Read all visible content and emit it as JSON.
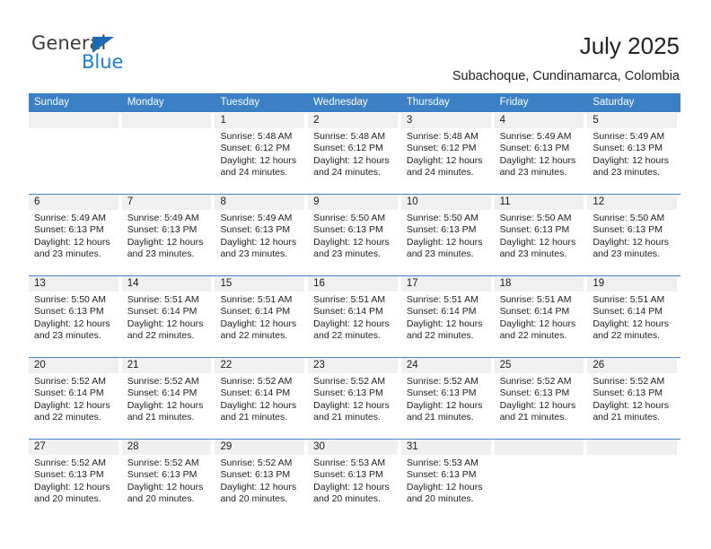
{
  "brand": {
    "name_part1": "General",
    "name_part2": "Blue",
    "flag_color": "#1a6ab4",
    "blue_color": "#1b7fd4"
  },
  "header": {
    "title": "July 2025",
    "subtitle": "Subachoque, Cundinamarca, Colombia"
  },
  "calendar": {
    "header_bg": "#3b7fc4",
    "date_band_bg": "#f0f0f0",
    "separator_color": "#4a86c5",
    "weekdays": [
      "Sunday",
      "Monday",
      "Tuesday",
      "Wednesday",
      "Thursday",
      "Friday",
      "Saturday"
    ],
    "weeks": [
      [
        {
          "day": "",
          "sunrise": "",
          "sunset": "",
          "daylight1": "",
          "daylight2": ""
        },
        {
          "day": "",
          "sunrise": "",
          "sunset": "",
          "daylight1": "",
          "daylight2": ""
        },
        {
          "day": "1",
          "sunrise": "Sunrise: 5:48 AM",
          "sunset": "Sunset: 6:12 PM",
          "daylight1": "Daylight: 12 hours",
          "daylight2": "and 24 minutes."
        },
        {
          "day": "2",
          "sunrise": "Sunrise: 5:48 AM",
          "sunset": "Sunset: 6:12 PM",
          "daylight1": "Daylight: 12 hours",
          "daylight2": "and 24 minutes."
        },
        {
          "day": "3",
          "sunrise": "Sunrise: 5:48 AM",
          "sunset": "Sunset: 6:12 PM",
          "daylight1": "Daylight: 12 hours",
          "daylight2": "and 24 minutes."
        },
        {
          "day": "4",
          "sunrise": "Sunrise: 5:49 AM",
          "sunset": "Sunset: 6:13 PM",
          "daylight1": "Daylight: 12 hours",
          "daylight2": "and 23 minutes."
        },
        {
          "day": "5",
          "sunrise": "Sunrise: 5:49 AM",
          "sunset": "Sunset: 6:13 PM",
          "daylight1": "Daylight: 12 hours",
          "daylight2": "and 23 minutes."
        }
      ],
      [
        {
          "day": "6",
          "sunrise": "Sunrise: 5:49 AM",
          "sunset": "Sunset: 6:13 PM",
          "daylight1": "Daylight: 12 hours",
          "daylight2": "and 23 minutes."
        },
        {
          "day": "7",
          "sunrise": "Sunrise: 5:49 AM",
          "sunset": "Sunset: 6:13 PM",
          "daylight1": "Daylight: 12 hours",
          "daylight2": "and 23 minutes."
        },
        {
          "day": "8",
          "sunrise": "Sunrise: 5:49 AM",
          "sunset": "Sunset: 6:13 PM",
          "daylight1": "Daylight: 12 hours",
          "daylight2": "and 23 minutes."
        },
        {
          "day": "9",
          "sunrise": "Sunrise: 5:50 AM",
          "sunset": "Sunset: 6:13 PM",
          "daylight1": "Daylight: 12 hours",
          "daylight2": "and 23 minutes."
        },
        {
          "day": "10",
          "sunrise": "Sunrise: 5:50 AM",
          "sunset": "Sunset: 6:13 PM",
          "daylight1": "Daylight: 12 hours",
          "daylight2": "and 23 minutes."
        },
        {
          "day": "11",
          "sunrise": "Sunrise: 5:50 AM",
          "sunset": "Sunset: 6:13 PM",
          "daylight1": "Daylight: 12 hours",
          "daylight2": "and 23 minutes."
        },
        {
          "day": "12",
          "sunrise": "Sunrise: 5:50 AM",
          "sunset": "Sunset: 6:13 PM",
          "daylight1": "Daylight: 12 hours",
          "daylight2": "and 23 minutes."
        }
      ],
      [
        {
          "day": "13",
          "sunrise": "Sunrise: 5:50 AM",
          "sunset": "Sunset: 6:13 PM",
          "daylight1": "Daylight: 12 hours",
          "daylight2": "and 23 minutes."
        },
        {
          "day": "14",
          "sunrise": "Sunrise: 5:51 AM",
          "sunset": "Sunset: 6:14 PM",
          "daylight1": "Daylight: 12 hours",
          "daylight2": "and 22 minutes."
        },
        {
          "day": "15",
          "sunrise": "Sunrise: 5:51 AM",
          "sunset": "Sunset: 6:14 PM",
          "daylight1": "Daylight: 12 hours",
          "daylight2": "and 22 minutes."
        },
        {
          "day": "16",
          "sunrise": "Sunrise: 5:51 AM",
          "sunset": "Sunset: 6:14 PM",
          "daylight1": "Daylight: 12 hours",
          "daylight2": "and 22 minutes."
        },
        {
          "day": "17",
          "sunrise": "Sunrise: 5:51 AM",
          "sunset": "Sunset: 6:14 PM",
          "daylight1": "Daylight: 12 hours",
          "daylight2": "and 22 minutes."
        },
        {
          "day": "18",
          "sunrise": "Sunrise: 5:51 AM",
          "sunset": "Sunset: 6:14 PM",
          "daylight1": "Daylight: 12 hours",
          "daylight2": "and 22 minutes."
        },
        {
          "day": "19",
          "sunrise": "Sunrise: 5:51 AM",
          "sunset": "Sunset: 6:14 PM",
          "daylight1": "Daylight: 12 hours",
          "daylight2": "and 22 minutes."
        }
      ],
      [
        {
          "day": "20",
          "sunrise": "Sunrise: 5:52 AM",
          "sunset": "Sunset: 6:14 PM",
          "daylight1": "Daylight: 12 hours",
          "daylight2": "and 22 minutes."
        },
        {
          "day": "21",
          "sunrise": "Sunrise: 5:52 AM",
          "sunset": "Sunset: 6:14 PM",
          "daylight1": "Daylight: 12 hours",
          "daylight2": "and 21 minutes."
        },
        {
          "day": "22",
          "sunrise": "Sunrise: 5:52 AM",
          "sunset": "Sunset: 6:14 PM",
          "daylight1": "Daylight: 12 hours",
          "daylight2": "and 21 minutes."
        },
        {
          "day": "23",
          "sunrise": "Sunrise: 5:52 AM",
          "sunset": "Sunset: 6:13 PM",
          "daylight1": "Daylight: 12 hours",
          "daylight2": "and 21 minutes."
        },
        {
          "day": "24",
          "sunrise": "Sunrise: 5:52 AM",
          "sunset": "Sunset: 6:13 PM",
          "daylight1": "Daylight: 12 hours",
          "daylight2": "and 21 minutes."
        },
        {
          "day": "25",
          "sunrise": "Sunrise: 5:52 AM",
          "sunset": "Sunset: 6:13 PM",
          "daylight1": "Daylight: 12 hours",
          "daylight2": "and 21 minutes."
        },
        {
          "day": "26",
          "sunrise": "Sunrise: 5:52 AM",
          "sunset": "Sunset: 6:13 PM",
          "daylight1": "Daylight: 12 hours",
          "daylight2": "and 21 minutes."
        }
      ],
      [
        {
          "day": "27",
          "sunrise": "Sunrise: 5:52 AM",
          "sunset": "Sunset: 6:13 PM",
          "daylight1": "Daylight: 12 hours",
          "daylight2": "and 20 minutes."
        },
        {
          "day": "28",
          "sunrise": "Sunrise: 5:52 AM",
          "sunset": "Sunset: 6:13 PM",
          "daylight1": "Daylight: 12 hours",
          "daylight2": "and 20 minutes."
        },
        {
          "day": "29",
          "sunrise": "Sunrise: 5:52 AM",
          "sunset": "Sunset: 6:13 PM",
          "daylight1": "Daylight: 12 hours",
          "daylight2": "and 20 minutes."
        },
        {
          "day": "30",
          "sunrise": "Sunrise: 5:53 AM",
          "sunset": "Sunset: 6:13 PM",
          "daylight1": "Daylight: 12 hours",
          "daylight2": "and 20 minutes."
        },
        {
          "day": "31",
          "sunrise": "Sunrise: 5:53 AM",
          "sunset": "Sunset: 6:13 PM",
          "daylight1": "Daylight: 12 hours",
          "daylight2": "and 20 minutes."
        },
        {
          "day": "",
          "sunrise": "",
          "sunset": "",
          "daylight1": "",
          "daylight2": ""
        },
        {
          "day": "",
          "sunrise": "",
          "sunset": "",
          "daylight1": "",
          "daylight2": ""
        }
      ]
    ]
  }
}
